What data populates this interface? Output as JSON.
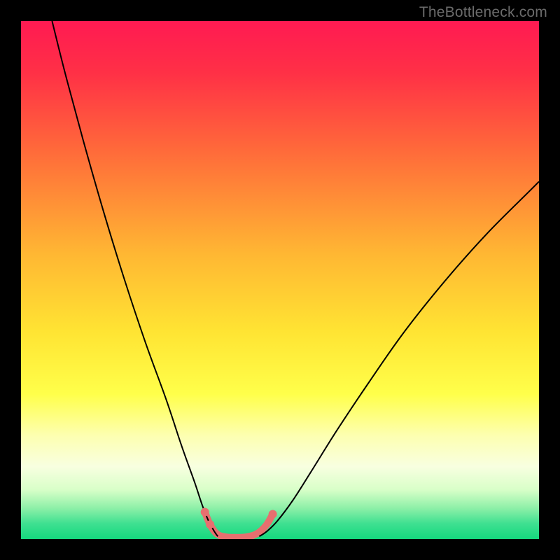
{
  "watermark": "TheBottleneck.com",
  "chart_data": {
    "type": "line",
    "title": "",
    "xlabel": "",
    "ylabel": "",
    "xlim": [
      0,
      100
    ],
    "ylim": [
      0,
      100
    ],
    "grid": false,
    "background_gradient_stops": [
      {
        "offset": 0.0,
        "color": "#ff1a52"
      },
      {
        "offset": 0.1,
        "color": "#ff3046"
      },
      {
        "offset": 0.25,
        "color": "#ff6a3a"
      },
      {
        "offset": 0.45,
        "color": "#ffb733"
      },
      {
        "offset": 0.6,
        "color": "#ffe433"
      },
      {
        "offset": 0.72,
        "color": "#ffff4a"
      },
      {
        "offset": 0.8,
        "color": "#fdffb0"
      },
      {
        "offset": 0.86,
        "color": "#f8ffe0"
      },
      {
        "offset": 0.905,
        "color": "#d8ffc8"
      },
      {
        "offset": 0.94,
        "color": "#8ef0a8"
      },
      {
        "offset": 0.97,
        "color": "#3fe091"
      },
      {
        "offset": 1.0,
        "color": "#15d87e"
      }
    ],
    "series": [
      {
        "name": "bottleneck-curve-left",
        "color": "#000000",
        "stroke_width": 2,
        "points": [
          {
            "x": 6.0,
            "y": 100.0
          },
          {
            "x": 8.5,
            "y": 90.0
          },
          {
            "x": 12.0,
            "y": 77.0
          },
          {
            "x": 16.0,
            "y": 63.0
          },
          {
            "x": 20.0,
            "y": 50.0
          },
          {
            "x": 24.0,
            "y": 38.0
          },
          {
            "x": 28.0,
            "y": 27.0
          },
          {
            "x": 31.0,
            "y": 18.0
          },
          {
            "x": 33.5,
            "y": 11.0
          },
          {
            "x": 35.0,
            "y": 6.5
          },
          {
            "x": 36.2,
            "y": 3.5
          },
          {
            "x": 37.3,
            "y": 1.5
          },
          {
            "x": 38.0,
            "y": 0.5
          }
        ]
      },
      {
        "name": "bottleneck-curve-right",
        "color": "#000000",
        "stroke_width": 2,
        "points": [
          {
            "x": 46.0,
            "y": 0.5
          },
          {
            "x": 47.5,
            "y": 1.5
          },
          {
            "x": 49.5,
            "y": 3.5
          },
          {
            "x": 52.5,
            "y": 7.5
          },
          {
            "x": 56.0,
            "y": 13.0
          },
          {
            "x": 61.0,
            "y": 21.0
          },
          {
            "x": 67.0,
            "y": 30.0
          },
          {
            "x": 74.0,
            "y": 40.0
          },
          {
            "x": 82.0,
            "y": 50.0
          },
          {
            "x": 90.0,
            "y": 59.0
          },
          {
            "x": 98.0,
            "y": 67.0
          },
          {
            "x": 100.0,
            "y": 69.0
          }
        ]
      },
      {
        "name": "optimal-region-highlight",
        "color": "#e76f6f",
        "stroke_width": 10,
        "linecap": "round",
        "points": [
          {
            "x": 35.5,
            "y": 5.2
          },
          {
            "x": 36.5,
            "y": 2.8
          },
          {
            "x": 37.8,
            "y": 1.0
          },
          {
            "x": 39.5,
            "y": 0.4
          },
          {
            "x": 41.5,
            "y": 0.3
          },
          {
            "x": 43.5,
            "y": 0.4
          },
          {
            "x": 45.5,
            "y": 1.0
          },
          {
            "x": 47.3,
            "y": 2.6
          },
          {
            "x": 48.6,
            "y": 4.8
          }
        ]
      }
    ],
    "markers": [
      {
        "name": "optimal-dot-1",
        "x": 35.5,
        "y": 5.2,
        "r": 6,
        "color": "#e76f6f"
      },
      {
        "name": "optimal-dot-2",
        "x": 36.5,
        "y": 2.8,
        "r": 6,
        "color": "#e76f6f"
      },
      {
        "name": "optimal-dot-3",
        "x": 48.6,
        "y": 4.8,
        "r": 6,
        "color": "#e76f6f"
      }
    ]
  }
}
